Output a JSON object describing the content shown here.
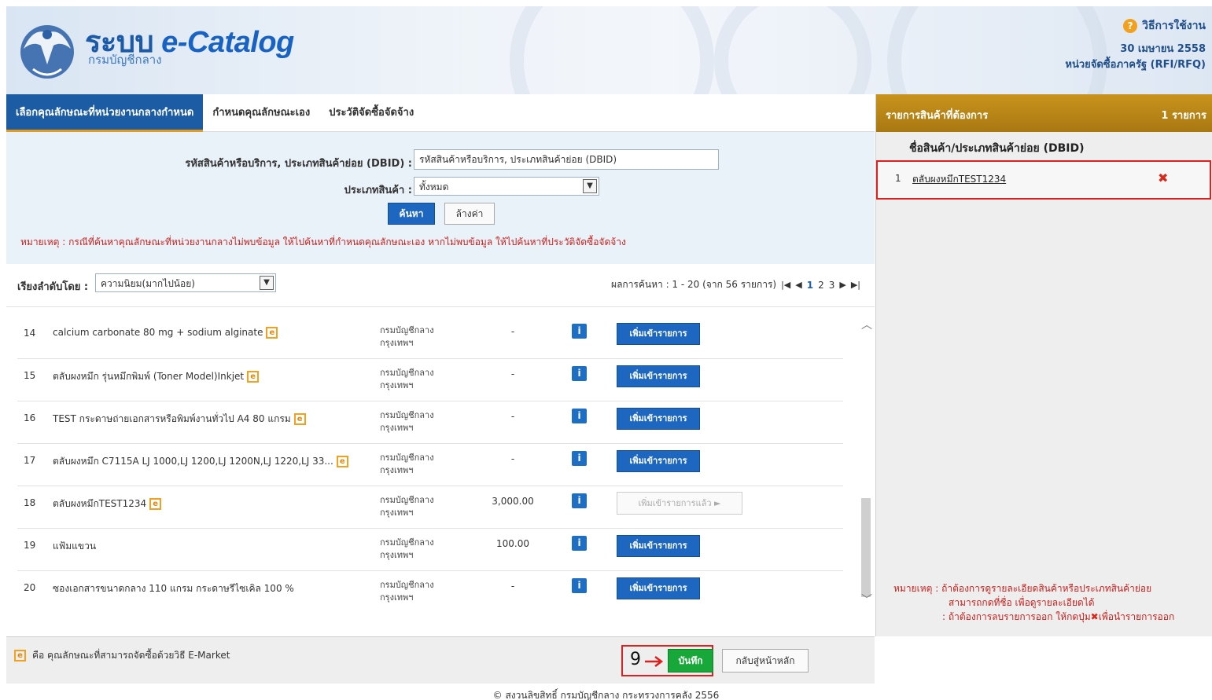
{
  "header": {
    "brand_title": "ระบบ",
    "brand_title_e": "e-Catalog",
    "brand_subtitle": "กรมบัญชีกลาง",
    "help_label": "วิธีการใช้งาน",
    "date": "30 เมษายน 2558",
    "unit": "หน่วยจัดซื้อภาครัฐ (RFI/RFQ)"
  },
  "tabs": [
    {
      "label": "เลือกคุณลักษณะที่หน่วยงานกลางกำหนด",
      "active": true
    },
    {
      "label": "กำหนดคุณลักษณะเอง",
      "active": false
    },
    {
      "label": "ประวัติจัดซื้อจัดจ้าง",
      "active": false
    }
  ],
  "search": {
    "code_label": "รหัสสินค้าหรือบริการ, ประเภทสินค้าย่อย (DBID) :",
    "code_value": "รหัสสินค้าหรือบริการ, ประเภทสินค้าย่อย (DBID)",
    "type_label": "ประเภทสินค้า :",
    "type_value": "ทั้งหมด",
    "search_button": "ค้นหา",
    "clear_button": "ล้างค่า",
    "note": "หมายเหตุ : กรณีที่ค้นหาคุณลักษณะที่หน่วยงานกลางไม่พบข้อมูล ให้ไปค้นหาที่กำหนดคุณลักษณะเอง หากไม่พบข้อมูล ให้ไปค้นหาที่ประวัติจัดซื้อจัดจ้าง"
  },
  "sort": {
    "label": "เรียงลำดับโดย :",
    "value": "ความนิยม(มากไปน้อย)",
    "result_text": "ผลการค้นหา : 1 - 20 (จาก 56 รายการ)",
    "pages": [
      "1",
      "2",
      "3"
    ]
  },
  "results": [
    {
      "num": "14",
      "name": "calcium carbonate 80 mg + sodium alginate",
      "agency1": "กรมบัญชีกลาง",
      "agency2": "กรุงเทพฯ",
      "price": "-",
      "button": "เพิ่มเข้ารายการ",
      "added": false
    },
    {
      "num": "15",
      "name": "ตลับผงหมึก รุ่นหมึกพิมพ์ (Toner Model)Inkjet",
      "agency1": "กรมบัญชีกลาง",
      "agency2": "กรุงเทพฯ",
      "price": "-",
      "button": "เพิ่มเข้ารายการ",
      "added": false
    },
    {
      "num": "16",
      "name": "TEST กระดาษถ่ายเอกสารหรือพิมพ์งานทั่วไป A4 80 แกรม",
      "agency1": "กรมบัญชีกลาง",
      "agency2": "กรุงเทพฯ",
      "price": "-",
      "button": "เพิ่มเข้ารายการ",
      "added": false
    },
    {
      "num": "17",
      "name": "ตลับผงหมึก C7115A LJ 1000,LJ 1200,LJ 1200N,LJ 1220,LJ 33...",
      "agency1": "กรมบัญชีกลาง",
      "agency2": "กรุงเทพฯ",
      "price": "-",
      "button": "เพิ่มเข้ารายการ",
      "added": false
    },
    {
      "num": "18",
      "name": "ตลับผงหมึกTEST1234",
      "agency1": "กรมบัญชีกลาง",
      "agency2": "กรุงเทพฯ",
      "price": "3,000.00",
      "button": "เพิ่มเข้ารายการแล้ว ►",
      "added": true
    },
    {
      "num": "19",
      "name": "แฟ้มแขวน",
      "agency1": "กรมบัญชีกลาง",
      "agency2": "กรุงเทพฯ",
      "price": "100.00",
      "button": "เพิ่มเข้ารายการ",
      "added": false
    },
    {
      "num": "20",
      "name": "ซองเอกสารขนาดกลาง 110 แกรม กระดาษรีไซเคิล 100 %",
      "agency1": "กรมบัญชีกลาง",
      "agency2": "กรุงเทพฯ",
      "price": "-",
      "button": "เพิ่มเข้ารายการ",
      "added": false
    }
  ],
  "footer": {
    "legend_badge": "e",
    "legend_text": "คือ คุณลักษณะที่สามารถจัดซื้อด้วยวิธี E-Market",
    "step_number": "9",
    "save_button": "บันทึก",
    "back_button": "กลับสู่หน้าหลัก",
    "copyright": "© สงวนลิขสิทธิ์ กรมบัญชีกลาง กระทรวงการคลัง 2556"
  },
  "cart": {
    "title": "รายการสินค้าที่ต้องการ",
    "count": "1 รายการ",
    "column": "ชื่อสินค้า/ประเภทสินค้าย่อย (DBID)",
    "items": [
      {
        "num": "1",
        "name": "ตลับผงหมึกTEST1234"
      }
    ],
    "note_line1": "หมายเหตุ : ถ้าต้องการดูรายละเอียดสินค้าหรือประเภทสินค้าย่อย",
    "note_line2": "สามารถกดที่ชื่อ เพื่อดูรายละเอียดได้",
    "note_line3a": ": ถ้าต้องการลบรายการออก ให้กดปุ่ม",
    "note_line3b": "เพื่อนำรายการออก"
  },
  "colors": {
    "tab_active": "#1c5ca5",
    "cart_header": "#b8861a",
    "add_button": "#1e67c0",
    "save_button": "#18a83a",
    "note_red": "#c8221d",
    "highlight_box": "#e02020"
  }
}
